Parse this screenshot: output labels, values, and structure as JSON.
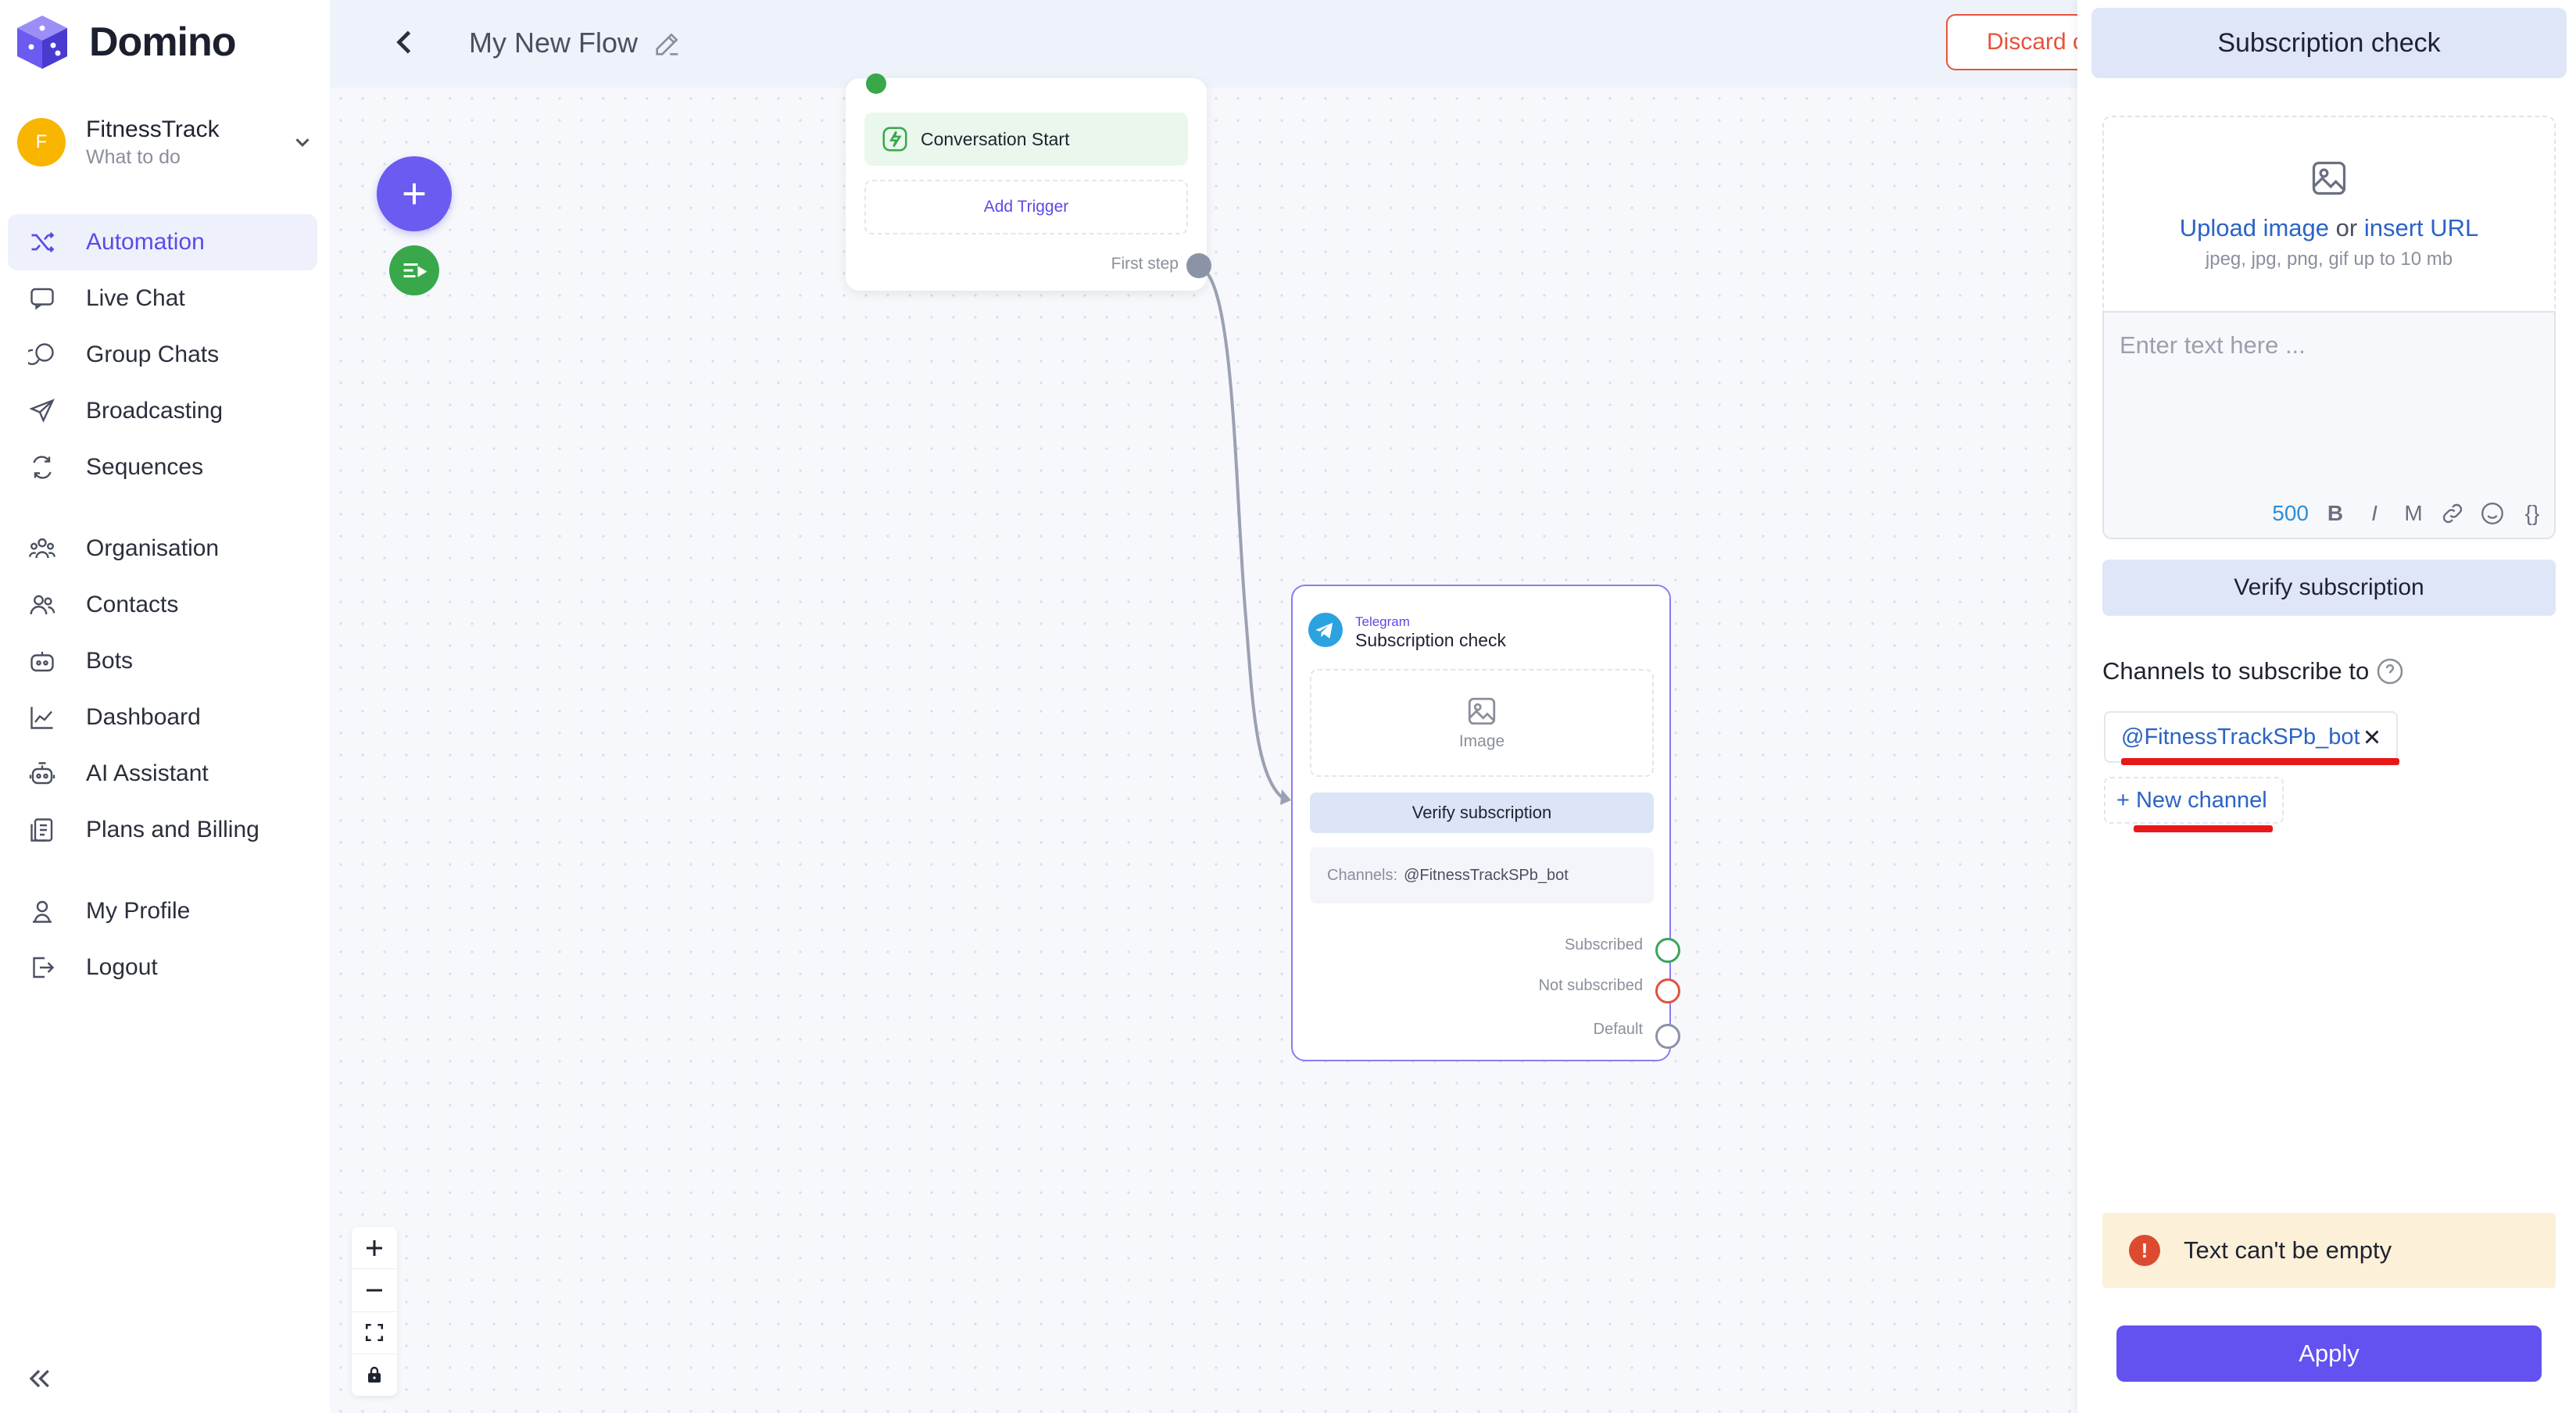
{
  "app": {
    "name": "Domino"
  },
  "org": {
    "initial": "F",
    "name": "FitnessTrack",
    "subtitle": "What to do"
  },
  "sidebar": {
    "items": [
      {
        "label": "Automation",
        "icon": "shuffle-icon",
        "active": true
      },
      {
        "label": "Live Chat",
        "icon": "chat-icon"
      },
      {
        "label": "Group Chats",
        "icon": "group-chat-icon"
      },
      {
        "label": "Broadcasting",
        "icon": "send-icon"
      },
      {
        "label": "Sequences",
        "icon": "sequence-icon"
      },
      {
        "label": "Organisation",
        "icon": "organisation-icon"
      },
      {
        "label": "Contacts",
        "icon": "contacts-icon"
      },
      {
        "label": "Bots",
        "icon": "bot-icon"
      },
      {
        "label": "Dashboard",
        "icon": "chart-icon"
      },
      {
        "label": "AI Assistant",
        "icon": "ai-icon"
      },
      {
        "label": "Plans and Billing",
        "icon": "billing-icon"
      },
      {
        "label": "My Profile",
        "icon": "user-icon"
      },
      {
        "label": "Logout",
        "icon": "logout-icon"
      }
    ]
  },
  "header": {
    "flow_title": "My New Flow",
    "discard_label": "Discard c"
  },
  "canvas": {
    "start_node": {
      "trigger_label": "Conversation Start",
      "add_trigger": "Add Trigger",
      "first_step": "First step"
    },
    "check_node": {
      "platform": "Telegram",
      "title": "Subscription check",
      "image_label": "Image",
      "verify_label": "Verify subscription",
      "channels_label": "Channels:",
      "channels_value": "@FitnessTrackSPb_bot",
      "outputs": [
        {
          "label": "Subscribed",
          "color": "#3aa45a"
        },
        {
          "label": "Not subscribed",
          "color": "#e0533d"
        },
        {
          "label": "Default",
          "color": "#8b93a6"
        }
      ]
    }
  },
  "panel": {
    "title": "Subscription check",
    "upload_link": "Upload image",
    "upload_or": "or",
    "insert_url": "insert URL",
    "upload_hint": "jpeg, jpg, png, gif up to 10 mb",
    "text_placeholder": "Enter text here ...",
    "char_count": "500",
    "fmt_bold": "B",
    "fmt_italic": "I",
    "fmt_mono": "M",
    "fmt_var": "{}",
    "verify_button": "Verify subscription",
    "channels_label": "Channels to subscribe to",
    "channel_chip": "@FitnessTrackSPb_bot",
    "new_channel": "+ New channel",
    "error_text": "Text can't be empty",
    "apply_label": "Apply"
  },
  "colors": {
    "accent": "#6352f0",
    "error": "#dc4b2f",
    "highlight": "#e8181a"
  }
}
